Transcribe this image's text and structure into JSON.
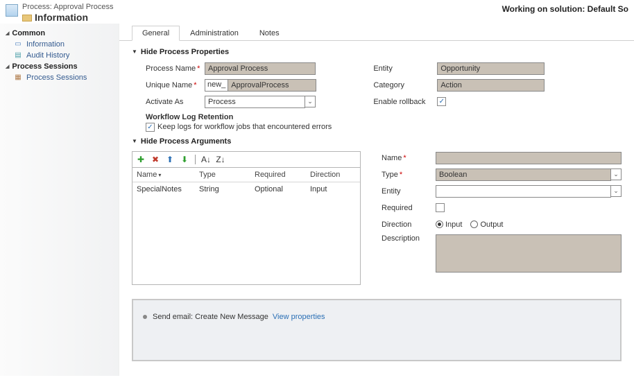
{
  "header": {
    "process_prefix": "Process:",
    "process_title": "Approval Process",
    "info_title": "Information",
    "working_on": "Working on solution: Default So"
  },
  "sidebar": {
    "common_heading": "Common",
    "items_common": [
      {
        "label": "Information"
      },
      {
        "label": "Audit History"
      }
    ],
    "sessions_heading": "Process Sessions",
    "items_sessions": [
      {
        "label": "Process Sessions"
      }
    ]
  },
  "tabs": {
    "general": "General",
    "administration": "Administration",
    "notes": "Notes"
  },
  "props": {
    "section_title": "Hide Process Properties",
    "process_name_label": "Process Name",
    "process_name_value": "Approval Process",
    "unique_name_label": "Unique Name",
    "unique_name_prefix": "new_",
    "unique_name_value": "ApprovalProcess",
    "activate_as_label": "Activate As",
    "activate_as_value": "Process",
    "workflow_log_heading": "Workflow Log Retention",
    "workflow_log_checkbox": "Keep logs for workflow jobs that encountered errors",
    "entity_label": "Entity",
    "entity_value": "Opportunity",
    "category_label": "Category",
    "category_value": "Action",
    "rollback_label": "Enable rollback"
  },
  "args": {
    "section_title": "Hide Process Arguments",
    "col_name": "Name",
    "col_type": "Type",
    "col_required": "Required",
    "col_direction": "Direction",
    "rows": [
      {
        "name": "SpecialNotes",
        "type": "String",
        "required": "Optional",
        "direction": "Input"
      }
    ],
    "right": {
      "name_label": "Name",
      "type_label": "Type",
      "type_value": "Boolean",
      "entity_label": "Entity",
      "required_label": "Required",
      "direction_label": "Direction",
      "direction_input": "Input",
      "direction_output": "Output",
      "description_label": "Description"
    }
  },
  "steps": {
    "text": "Send email:  Create New Message",
    "link": "View properties"
  }
}
